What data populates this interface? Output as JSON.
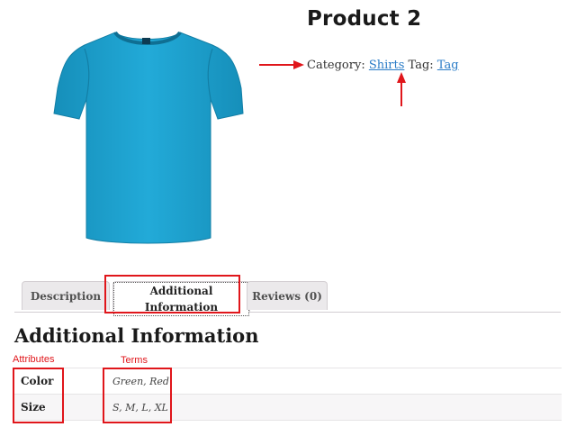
{
  "product": {
    "title": "Product 2",
    "category_label": "Category:",
    "category_link": "Shirts",
    "tag_label": "Tag:",
    "tag_link": "Tag",
    "image_icon": "tshirt-image",
    "shirt_color": "#1ea3d0"
  },
  "tabs": [
    {
      "label": "Description",
      "active": false
    },
    {
      "label": "Additional Information",
      "active": true
    },
    {
      "label": "Reviews (0)",
      "active": false
    }
  ],
  "section": {
    "heading": "Additional Information"
  },
  "annotations": {
    "attributes_label": "Attributes",
    "terms_label": "Terms",
    "color": "#e0161b"
  },
  "attributes": [
    {
      "name": "Color",
      "value": "Green, Red"
    },
    {
      "name": "Size",
      "value": "S, M, L, XL"
    }
  ]
}
